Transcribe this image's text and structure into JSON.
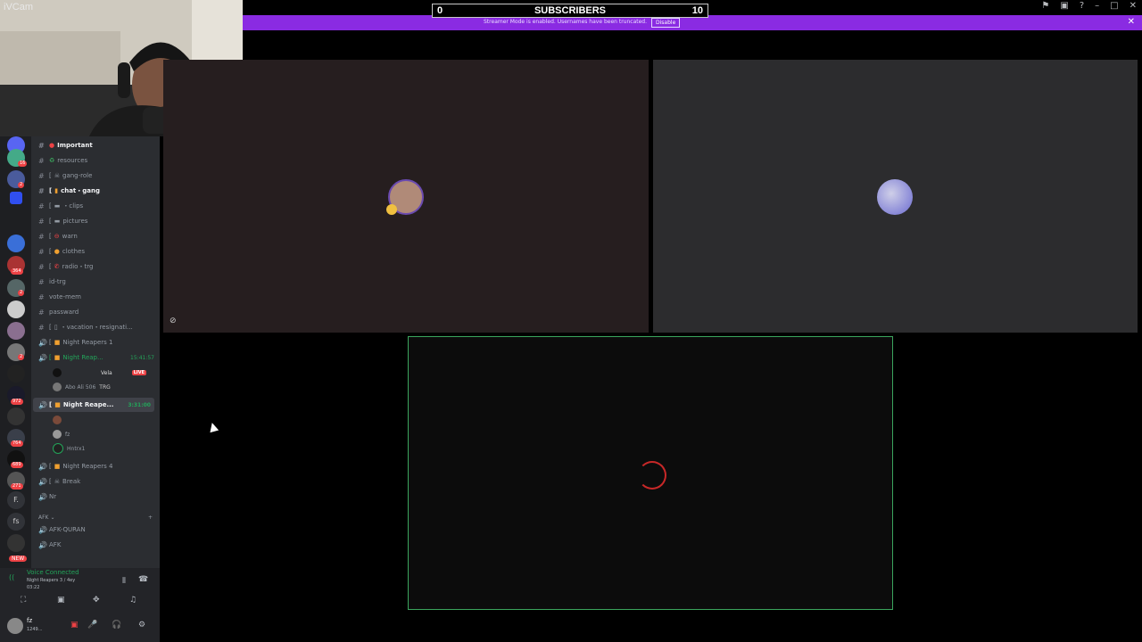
{
  "webcam": {
    "label": "iVCam"
  },
  "subscribers": {
    "left": "0",
    "title": "SUBSCRIBERS",
    "right": "10"
  },
  "streamer_bar": {
    "message": "Streamer Mode is enabled. Usernames have been truncated.",
    "button": "Disable"
  },
  "channels": [
    {
      "label": "Important",
      "type": "text",
      "prefix": "! "
    },
    {
      "label": "resources",
      "type": "text"
    },
    {
      "label": "gang-role",
      "type": "text",
      "prefix": "[ "
    },
    {
      "label": "chat・gang",
      "type": "text",
      "prefix": "[ ",
      "bright": true
    },
    {
      "label": "clips",
      "type": "text",
      "prefix": "[ "
    },
    {
      "label": "pictures",
      "type": "text",
      "prefix": "[ "
    },
    {
      "label": "warn",
      "type": "text",
      "prefix": "[ "
    },
    {
      "label": "clothes",
      "type": "text",
      "prefix": "[ "
    },
    {
      "label": "radio・trg",
      "type": "text",
      "prefix": "[ "
    },
    {
      "label": "id-trg",
      "type": "text"
    },
    {
      "label": "vote-mem",
      "type": "text"
    },
    {
      "label": "passward",
      "type": "text"
    },
    {
      "label": "・vacation・resignati...",
      "type": "text",
      "prefix": "[ "
    }
  ],
  "voice_channels": {
    "vc1": {
      "label": "Night Reapers 1"
    },
    "vc2": {
      "label": "Night Reap...",
      "time": "15:41:57"
    },
    "vc2_users": [
      {
        "name": "Vela",
        "badge": "LIVE"
      },
      {
        "name": "Abo Ali 506",
        "tag": "TRG"
      }
    ],
    "vc3": {
      "label": "Night Reape...",
      "time": "3:31:00"
    },
    "vc3_users": [
      {
        "name": "fz"
      },
      {
        "name": "Hntrx1"
      }
    ],
    "vc4": {
      "label": "Night Reapers 4"
    },
    "break": {
      "label": "Break"
    },
    "nr": {
      "label": "Nr"
    }
  },
  "afk_category": {
    "label": "AFK",
    "items": [
      "AFK-QURAN",
      "AFK"
    ]
  },
  "voice_panel": {
    "status": "Voice Connected",
    "channel": "Night Reapers 3 / 4ey",
    "elapsed": "03:22",
    "user_name": "fz",
    "user_sub": "1249..."
  },
  "server_badges": [
    "16",
    "2",
    "364",
    "2",
    "2",
    "972",
    "764",
    "689",
    "271",
    "F.",
    "fs",
    "NEW"
  ],
  "colors": {
    "accent_purple": "#8a2be2",
    "speaking_green": "#3ba55d",
    "live_red": "#ed4245"
  }
}
